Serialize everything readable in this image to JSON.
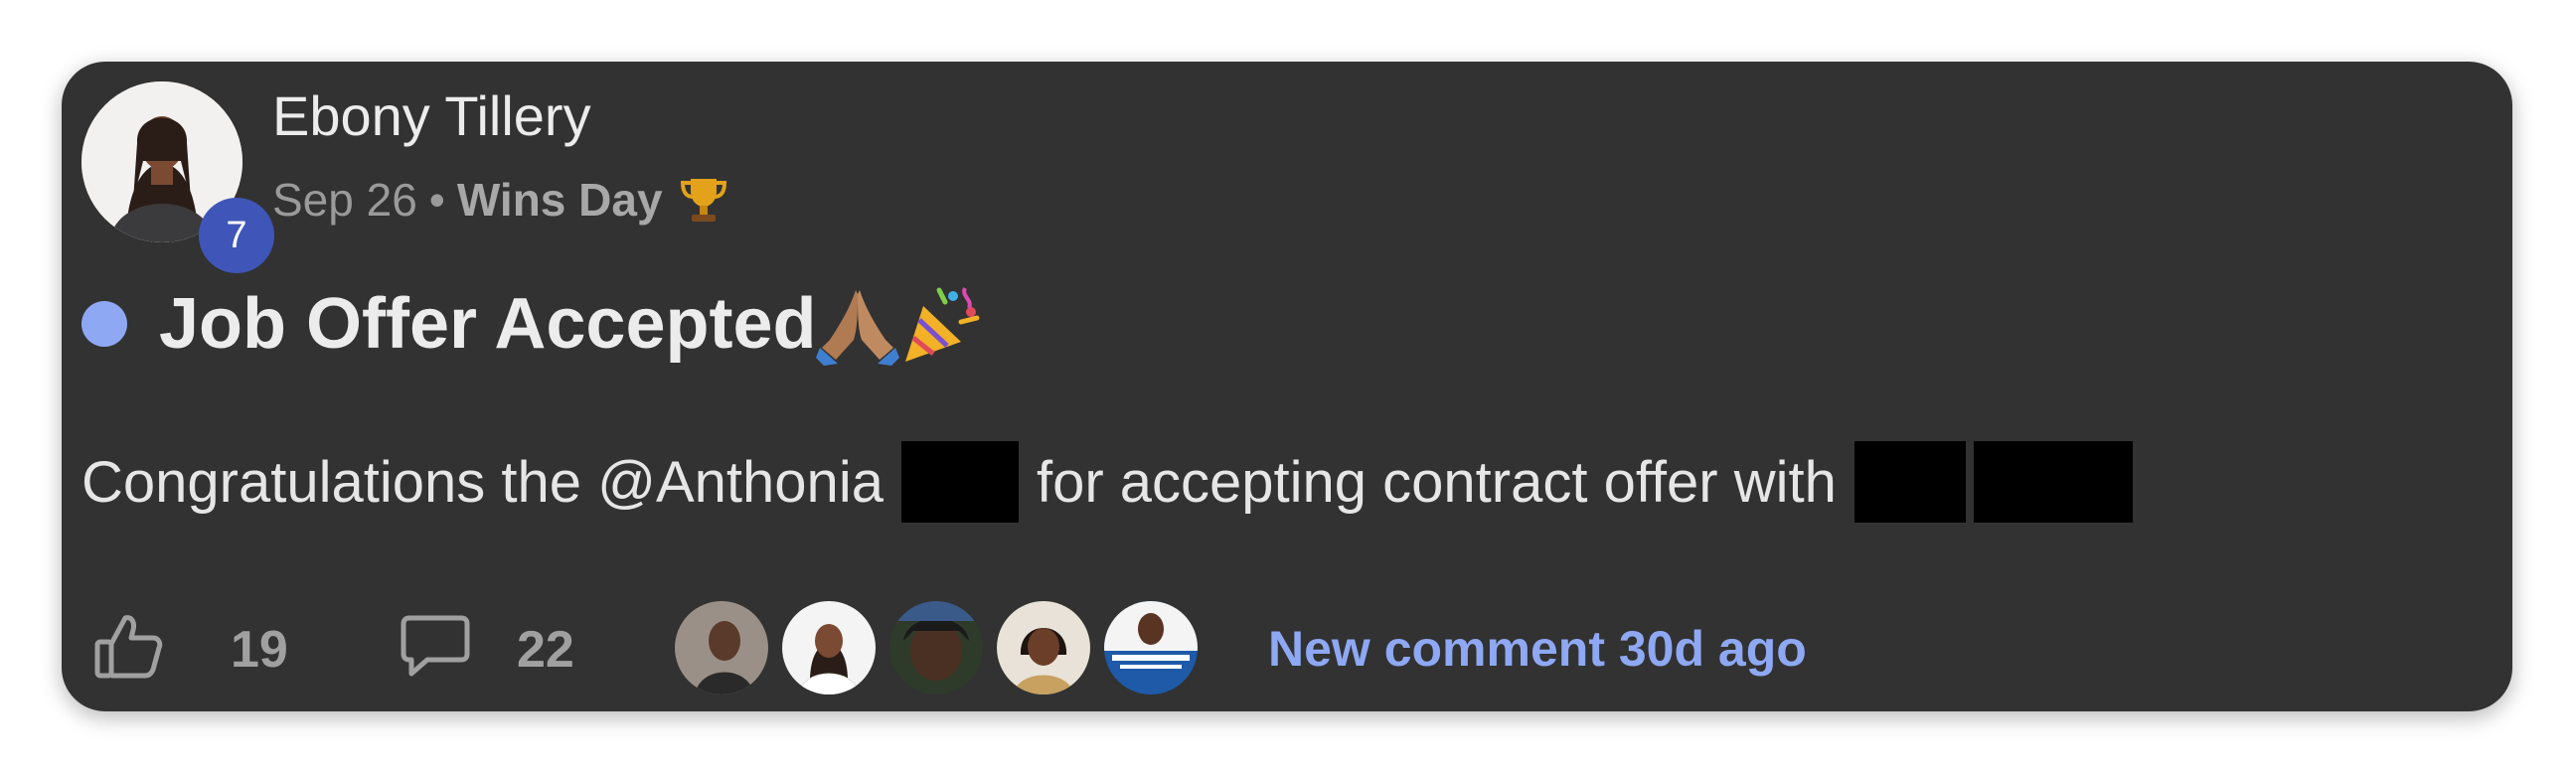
{
  "post": {
    "author": {
      "name": "Ebony Tillery",
      "level": "7"
    },
    "date": "Sep 26",
    "separator": "•",
    "category": "Wins Day",
    "category_icon": "trophy-icon",
    "title": "Job Offer Accepted",
    "title_icons": [
      "praying-hands-icon",
      "party-popper-icon"
    ],
    "body": {
      "text_before": "Congratulations the @Anthonia",
      "text_middle": "for accepting contract offer with",
      "redacted_segments": 3
    }
  },
  "footer": {
    "like_count": "19",
    "comment_count": "22",
    "commenter_avatars": 5,
    "new_comment_label": "New comment 30d ago"
  },
  "colors": {
    "card_bg": "#323232",
    "accent": "#8ea8f4",
    "badge": "#3f56b8"
  }
}
